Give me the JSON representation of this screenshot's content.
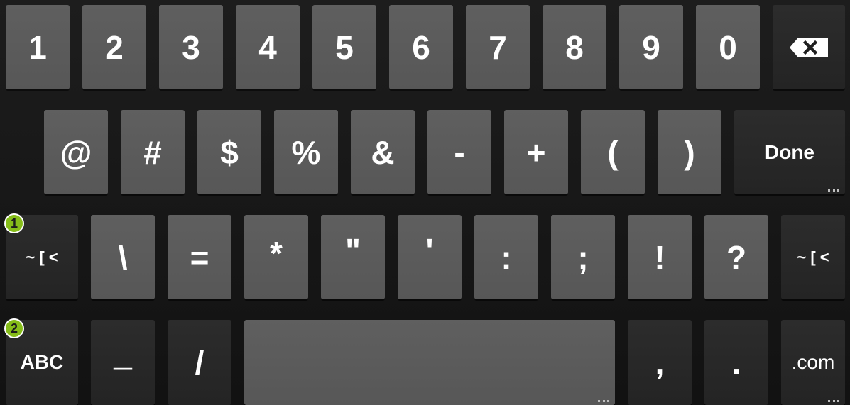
{
  "keyboard": {
    "number_row": [
      "1",
      "2",
      "3",
      "4",
      "5",
      "6",
      "7",
      "8",
      "9",
      "0"
    ],
    "symbol_row": [
      "@",
      "#",
      "$",
      "%",
      "&",
      "-",
      "+",
      "(",
      ")"
    ],
    "done_label": "Done",
    "symbol_row2": [
      "\\",
      "=",
      "*",
      "\"",
      "'",
      ":",
      ";",
      "!",
      "?"
    ],
    "more_symbols_label": "~ [ <",
    "abc_label": "ABC",
    "bottom_left_keys": [
      "_",
      "/"
    ],
    "bottom_right_keys": [
      ",",
      "."
    ],
    "com_label": ".com"
  },
  "annotations": {
    "badge_1": "1",
    "badge_2": "2"
  },
  "colors": {
    "key_light": "#5b5b5b",
    "key_dark": "#282828",
    "background": "#151515",
    "badge": "#86bd1a"
  },
  "icons": {
    "backspace": "backspace-icon"
  }
}
